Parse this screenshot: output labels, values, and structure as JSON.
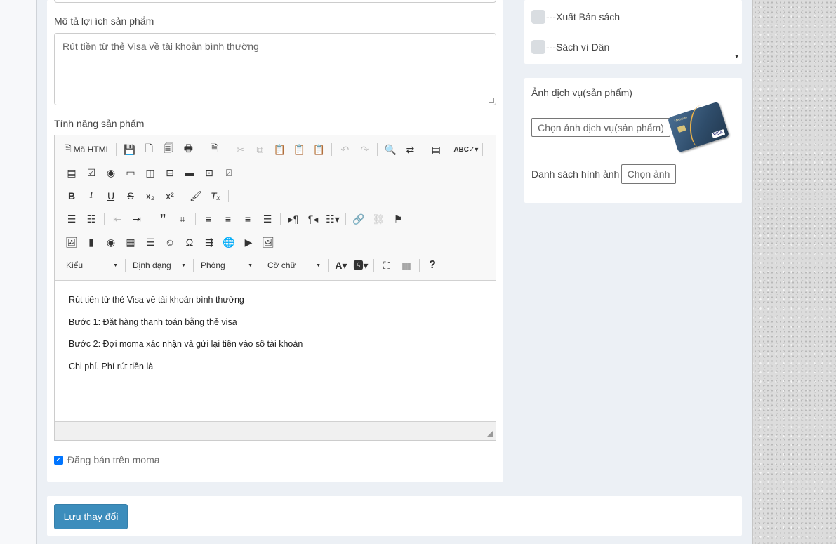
{
  "form": {
    "benefit_label": "Mô tả lợi ích sản phẩm",
    "benefit_value": "Rút tiền từ thẻ Visa về tài khoản bình thường",
    "features_label": "Tính năng sản phẩm",
    "on_sale_label": "Đăng bán trên moma",
    "on_sale_checked": true
  },
  "editor": {
    "source_label": "Mã HTML",
    "style_combo": "Kiểu",
    "format_combo": "Định dạng",
    "font_combo": "Phông",
    "size_combo": "Cỡ chữ",
    "help_label": "?",
    "content": [
      "Rút tiền từ thẻ Visa về tài khoản bình thường",
      "Bước 1: Đặt hàng thanh toán bằng thẻ visa",
      "Bước 2: Đợi moma xác nhận và gửi lại tiền vào số tài khoản",
      "Chi phí. Phí rút tiền là"
    ],
    "icons": {
      "row1": [
        "source-icon",
        "save-icon",
        "new-page-icon",
        "preview-icon",
        "print-icon",
        "templates-icon",
        "cut-icon",
        "copy-icon",
        "paste-icon",
        "paste-text-icon",
        "paste-word-icon",
        "undo-icon",
        "redo-icon",
        "find-icon",
        "replace-icon",
        "select-all-icon",
        "spellcheck-icon"
      ],
      "row2": [
        "form-icon",
        "checkbox-icon",
        "radio-icon",
        "textfield-icon",
        "textarea-icon",
        "select-icon",
        "button-icon",
        "image-button-icon",
        "hidden-field-icon"
      ],
      "row3": [
        "bold-icon",
        "italic-icon",
        "underline-icon",
        "strike-icon",
        "subscript-icon",
        "superscript-icon",
        "copy-format-icon",
        "remove-format-icon"
      ],
      "row4": [
        "numbered-list-icon",
        "bulleted-list-icon",
        "outdent-icon",
        "indent-icon",
        "blockquote-icon",
        "div-icon",
        "align-left-icon",
        "align-center-icon",
        "align-right-icon",
        "justify-icon",
        "ltr-icon",
        "rtl-icon",
        "language-icon",
        "link-icon",
        "unlink-icon",
        "anchor-icon"
      ],
      "row5": [
        "image-icon",
        "flash-icon",
        "embed-icon",
        "table-icon",
        "horizontal-rule-icon",
        "smiley-icon",
        "special-char-icon",
        "page-break-icon",
        "iframe-icon",
        "youtube-icon",
        "gallery-icon"
      ]
    }
  },
  "categories": {
    "items": [
      {
        "label": "---Xuất Bản sách",
        "checked": false
      },
      {
        "label": "---Sách vì Dân",
        "checked": false
      }
    ]
  },
  "service_image": {
    "title": "Ảnh dịch vụ(sản phẩm)",
    "choose_label": "Chọn ảnh dịch vụ(sản phẩm)",
    "gallery_label": "Danh sách hình ảnh",
    "gallery_button": "Chọn ảnh",
    "card_brand": "VISA",
    "card_issuer": "Meridian"
  },
  "actions": {
    "save_label": "Lưu thay đổi"
  },
  "colors": {
    "primary": "#3c8dbc",
    "background": "#ecf0f5",
    "checkbox": "#0075ff"
  }
}
